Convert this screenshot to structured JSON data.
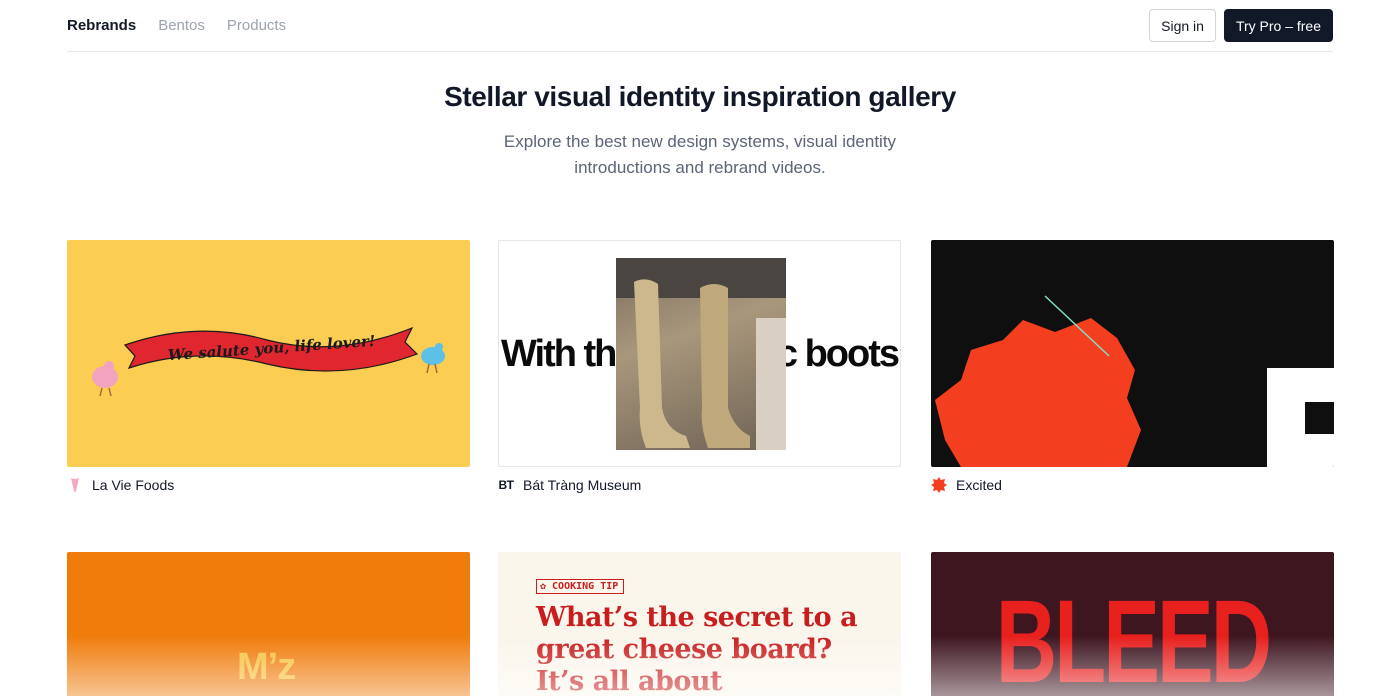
{
  "nav": {
    "links": [
      "Rebrands",
      "Bentos",
      "Products"
    ],
    "sign_in": "Sign in",
    "try_pro": "Try Pro – free"
  },
  "hero": {
    "title": "Stellar visual identity inspiration gallery",
    "subtitle": "Explore the best new design systems, visual identity introductions and rebrand videos."
  },
  "gallery": [
    {
      "name": "La Vie Foods",
      "banner_text": "We salute you, life lover!",
      "icon": "heart-icon",
      "bg": "#fbcd52"
    },
    {
      "name": "Bát Tràng Museum",
      "icon_text": "BT",
      "thumb_left": "With the",
      "thumb_right": "mic boots",
      "bg": "#ffffff"
    },
    {
      "name": "Excited",
      "icon": "starburst-icon",
      "bg": "#0f0f0f",
      "accent": "#f43e20"
    },
    {
      "thumb_text": "M’z",
      "bg": "#f07c0c"
    },
    {
      "tag": "COOKING TIP",
      "headline": "What’s the secret to a great cheese board? It’s all about",
      "bg": "#fbf6ec",
      "accent": "#c81e1e"
    },
    {
      "thumb_text": "BLEED",
      "bg": "#3e1620",
      "accent": "#e8201e"
    }
  ]
}
